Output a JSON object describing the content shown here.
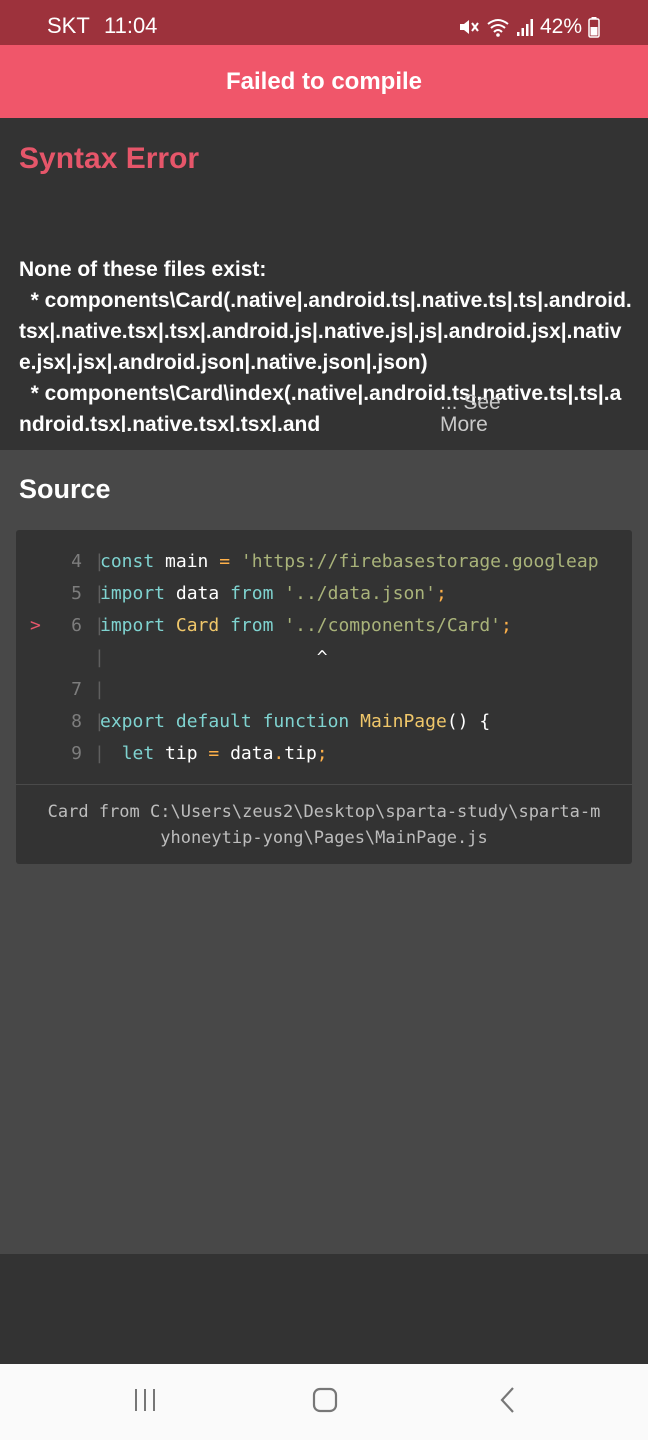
{
  "status_bar": {
    "carrier": "SKT",
    "time": "11:04",
    "battery_text": "42%",
    "icons": [
      "mute-icon",
      "wifi-icon",
      "signal-icon",
      "battery-icon"
    ]
  },
  "header": {
    "title": "Failed to compile"
  },
  "error": {
    "title": "Syntax Error",
    "message": "None of these files exist:\n  * components\\Card(.native|.android.ts|.native.ts|.ts|.android.tsx|.native.tsx|.tsx|.android.js|.native.js|.js|.android.jsx|.native.jsx|.jsx|.android.json|.native.json|.json)\n  * components\\Card\\index(.native|.android.ts|.native.ts|.ts|.android.tsx|.native.tsx|.tsx|.and",
    "see_more": "... See More"
  },
  "source": {
    "title": "Source",
    "code": [
      {
        "num": "4",
        "marker": "",
        "tokens": [
          {
            "t": "kw",
            "v": "const"
          },
          {
            "t": "plain",
            "v": " main "
          },
          {
            "t": "op",
            "v": "="
          },
          {
            "t": "plain",
            "v": " "
          },
          {
            "t": "str",
            "v": "'https://firebasestorage.googleap"
          }
        ]
      },
      {
        "num": "5",
        "marker": "",
        "tokens": [
          {
            "t": "kw",
            "v": "import"
          },
          {
            "t": "plain",
            "v": " data "
          },
          {
            "t": "kw",
            "v": "from"
          },
          {
            "t": "plain",
            "v": " "
          },
          {
            "t": "str",
            "v": "'../data.json'"
          },
          {
            "t": "op",
            "v": ";"
          }
        ]
      },
      {
        "num": "6",
        "marker": ">",
        "tokens": [
          {
            "t": "kw",
            "v": "import"
          },
          {
            "t": "plain",
            "v": " "
          },
          {
            "t": "ident",
            "v": "Card"
          },
          {
            "t": "plain",
            "v": " "
          },
          {
            "t": "kw",
            "v": "from"
          },
          {
            "t": "plain",
            "v": " "
          },
          {
            "t": "str",
            "v": "'../components/Card'"
          },
          {
            "t": "op",
            "v": ";"
          }
        ]
      },
      {
        "num": "",
        "marker": "",
        "tokens": [
          {
            "t": "caret",
            "v": "                    ^"
          }
        ]
      },
      {
        "num": "7",
        "marker": "",
        "tokens": []
      },
      {
        "num": "8",
        "marker": "",
        "tokens": [
          {
            "t": "kw",
            "v": "export"
          },
          {
            "t": "plain",
            "v": " "
          },
          {
            "t": "kw",
            "v": "default"
          },
          {
            "t": "plain",
            "v": " "
          },
          {
            "t": "kw",
            "v": "function"
          },
          {
            "t": "plain",
            "v": " "
          },
          {
            "t": "ident",
            "v": "MainPage"
          },
          {
            "t": "plain",
            "v": "() {"
          }
        ]
      },
      {
        "num": "9",
        "marker": "",
        "tokens": [
          {
            "t": "plain",
            "v": "  "
          },
          {
            "t": "kw",
            "v": "let"
          },
          {
            "t": "plain",
            "v": " tip "
          },
          {
            "t": "op",
            "v": "="
          },
          {
            "t": "plain",
            "v": " data"
          },
          {
            "t": "op",
            "v": "."
          },
          {
            "t": "plain",
            "v": "tip"
          },
          {
            "t": "op",
            "v": ";"
          }
        ]
      }
    ],
    "footer_line1": "Card from C:\\Users\\zeus2\\Desktop\\sparta-study\\sparta-m",
    "footer_line2": "yhoneytip-yong\\Pages\\MainPage.js"
  },
  "nav_bar": {
    "buttons": [
      "recent-apps-icon",
      "home-icon",
      "back-icon"
    ]
  }
}
